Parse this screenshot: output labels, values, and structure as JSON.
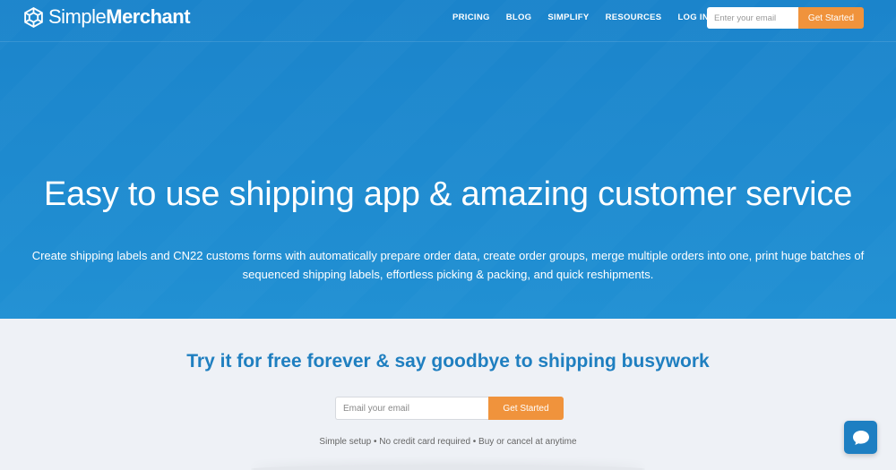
{
  "brand": {
    "name_light": "Simple",
    "name_bold": "Merchant",
    "logo_icon": "snowflake-logo-icon"
  },
  "nav": {
    "items": [
      {
        "label": "PRICING"
      },
      {
        "label": "BLOG"
      },
      {
        "label": "SIMPLIFY"
      },
      {
        "label": "RESOURCES"
      },
      {
        "label": "LOG IN"
      }
    ],
    "email_placeholder": "Enter your email",
    "cta_label": "Get Started"
  },
  "hero": {
    "headline": "Easy to use shipping app & amazing customer service",
    "subtext": "Create shipping labels and CN22 customs forms with automatically prepare order data, create order groups, merge multiple orders into one, print huge batches of sequenced shipping labels, effortless picking & packing, and quick reshipments."
  },
  "signup": {
    "title": "Try it for free forever & say goodbye to shipping busywork",
    "email_placeholder": "Email your email",
    "cta_label": "Get Started",
    "note": "Simple setup • No credit card required • Buy or cancel at anytime"
  },
  "chat": {
    "icon": "chat-bubble-icon"
  },
  "colors": {
    "hero_blue": "#1e88cd",
    "accent_orange": "#f0933c",
    "title_blue": "#1f7fc0",
    "page_bg": "#eef1f6"
  }
}
